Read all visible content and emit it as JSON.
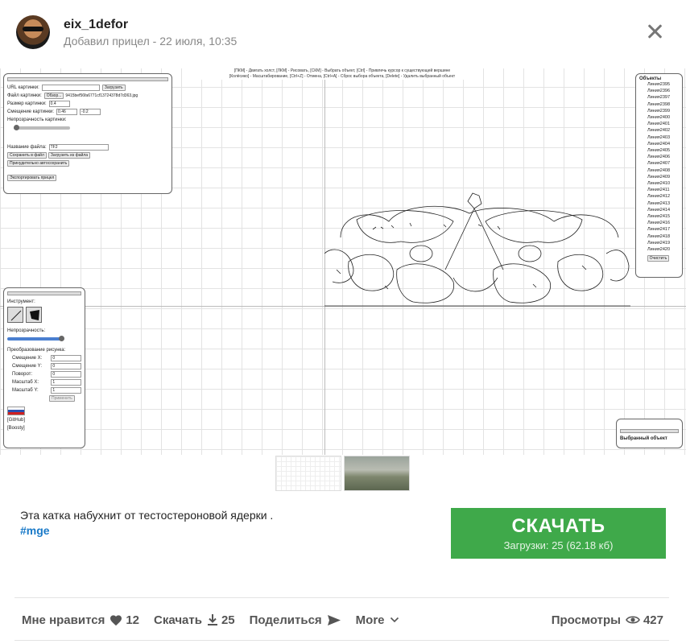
{
  "header": {
    "username": "eix_1defor",
    "subline": "Добавил прицел - 22 июля, 10:35"
  },
  "screenshot": {
    "hint_line1": "[ПКМ] - Двигать холст, [ЛКМ] - Рисовать, [СКМ] - Выбрать объект, [Ctrl] - Привлечь курсор к существующей вершине",
    "hint_line2": "[Колёсико] - Масштабирование, [Ctrl+Z] - Отмена, [Ctrl+A] - Сброс выбора объекта, [Delete] - Удалить выбранный объект",
    "settings": {
      "url_label": "URL картинки:",
      "load_btn": "Загрузить",
      "file_label": "Файл картинки:",
      "browse_btn": "Обзор...",
      "file_name": "9415bef56fa6771cf13724378d7d363.jpg",
      "size_label": "Размер картинки:",
      "size_value": "0.4",
      "offset_label": "Смещение картинки:",
      "offset_x": "0.46",
      "offset_y": "-0.2",
      "opacity_label": "Непрозрачность картинки:",
      "filename_label": "Название файла:",
      "filename_value": "TF2",
      "save_btn": "Сохранить в файл",
      "load_file_btn": "Загрузить из файла",
      "autosave_btn": "Принудительно автосохранить",
      "export_btn": "Экспортировать прицел"
    },
    "tools": {
      "instrument_label": "Инструмент:",
      "opacity_label": "Непрозрачность:",
      "transform_label": "Преобразование рисунка:",
      "offset_x_label": "Смещение X:",
      "offset_x": "0",
      "offset_y_label": "Смещение Y:",
      "offset_y": "0",
      "rotate_label": "Поворот:",
      "rotate": "0",
      "scale_x_label": "Масштаб X:",
      "scale_x": "1",
      "scale_y_label": "Масштаб Y:",
      "scale_y": "1",
      "apply_btn": "Применить",
      "github": "[GitHub]",
      "boosty": "[Boosty]"
    },
    "objects": {
      "title": "Объекты",
      "items": [
        "Линия2395",
        "Линия2396",
        "Линия2397",
        "Линия2398",
        "Линия2399",
        "Линия2400",
        "Линия2401",
        "Линия2402",
        "Линия2403",
        "Линия2404",
        "Линия2405",
        "Линия2406",
        "Линия2407",
        "Линия2408",
        "Линия2409",
        "Линия2410",
        "Линия2411",
        "Линия2412",
        "Линия2413",
        "Линия2414",
        "Линия2415",
        "Линия2416",
        "Линия2417",
        "Линия2418",
        "Линия2419",
        "Линия2420"
      ],
      "clear_btn": "Очистить"
    },
    "selected": {
      "title": "Выбранный объект"
    }
  },
  "description": {
    "text": "Эта катка набухнит от тестостероновой ядерки .",
    "tag": "#mge"
  },
  "download": {
    "title": "СКАЧАТЬ",
    "sub": "Загрузки: 25 (62.18 кб)"
  },
  "actions": {
    "like_label": "Мне нравится",
    "like_count": "12",
    "download_label": "Скачать",
    "download_count": "25",
    "share_label": "Поделиться",
    "more_label": "More",
    "views_label": "Просмотры",
    "views_count": "427"
  }
}
